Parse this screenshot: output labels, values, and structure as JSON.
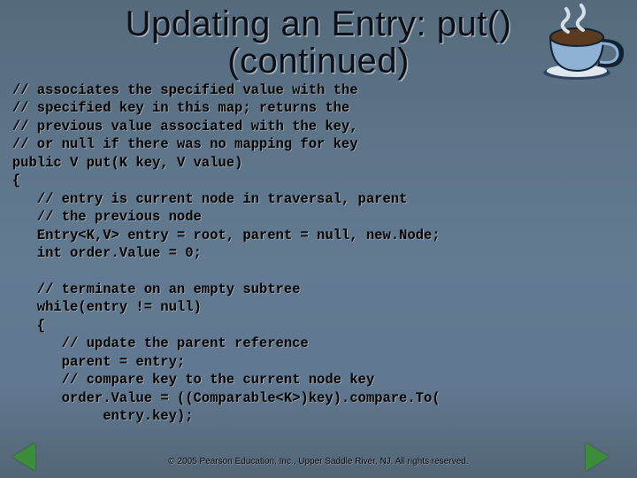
{
  "title": {
    "line1": "Updating an Entry: put()",
    "line2": "(continued)"
  },
  "code_lines": [
    "// associates the specified value with the",
    "// specified key in this map; returns the",
    "// previous value associated with the key,",
    "// or null if there was no mapping for key",
    "public V put(K key, V value)",
    "{",
    "   // entry is current node in traversal, parent",
    "   // the previous node",
    "   Entry<K,V> entry = root, parent = null, new.Node;",
    "   int order.Value = 0;",
    "",
    "   // terminate on an empty subtree",
    "   while(entry != null)",
    "   {",
    "      // update the parent reference",
    "      parent = entry;",
    "      // compare key to the current node key",
    "      order.Value = ((Comparable<K>)key).compare.To(",
    "           entry.key);"
  ],
  "footer": "© 2005 Pearson Education, Inc., Upper Saddle River, NJ.  All rights reserved.",
  "icons": {
    "corner": "coffee-cup-icon",
    "back": "green-back-arrow",
    "forward": "green-forward-arrow"
  }
}
